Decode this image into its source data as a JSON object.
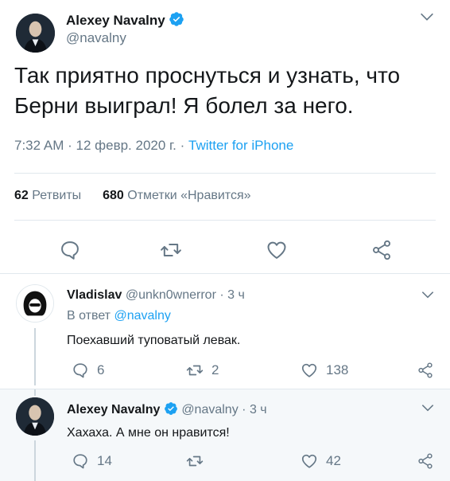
{
  "main_tweet": {
    "author_name": "Alexey Navalny",
    "handle": "@navalny",
    "text": "Так приятно проснуться и узнать, что Берни выиграл! Я болел за него.",
    "time": "7:32 AM",
    "date": "12 февр. 2020 г.",
    "source": "Twitter for iPhone",
    "retweets_count": "62",
    "retweets_label": "Ретвиты",
    "likes_count": "680",
    "likes_label": "Отметки «Нравится»",
    "icons": [
      "reply-icon",
      "retweet-icon",
      "like-icon",
      "share-icon",
      "chevron-down-icon",
      "verified-badge-icon"
    ]
  },
  "replies": [
    {
      "author_name": "Vladislav",
      "handle": "@unkn0wnerror",
      "age": "3 ч",
      "reply_to_label": "В ответ",
      "reply_to_handle": "@navalny",
      "text": "Поехавший туповатый левак.",
      "reply_count": "6",
      "retweet_count": "2",
      "like_count": "138"
    },
    {
      "author_name": "Alexey Navalny",
      "handle": "@navalny",
      "age": "3 ч",
      "text": "Хахаха. А мне он нравится!",
      "reply_count": "14",
      "retweet_count": "",
      "like_count": "42"
    }
  ],
  "colors": {
    "accent": "#1da1f2",
    "text": "#14171a",
    "muted": "#657786",
    "divider": "#e1e8ed",
    "highlight_bg": "#f5f8fa"
  }
}
